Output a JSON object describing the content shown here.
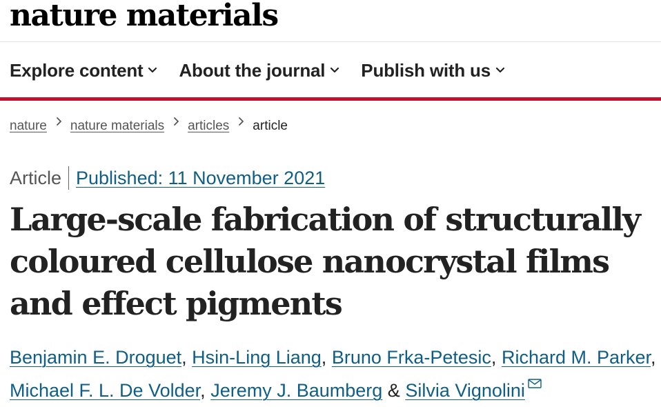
{
  "header": {
    "logo_text": "nature materials"
  },
  "nav": {
    "items": [
      {
        "label": "Explore content"
      },
      {
        "label": "About the journal"
      },
      {
        "label": "Publish with us"
      }
    ]
  },
  "breadcrumb": {
    "items": [
      "nature",
      "nature materials",
      "articles"
    ],
    "current": "article",
    "separator_icon": "chevron-right-icon"
  },
  "article": {
    "type": "Article",
    "published": "Published: 11 November 2021",
    "title": "Large-scale fabrication of structurally coloured cellulose nanocrystal films and effect pigments",
    "authors": [
      "Benjamin E. Droguet",
      "Hsin-Ling Liang",
      "Bruno Frka-Petesic",
      "Richard M. Parker",
      "Michael F. L. De Volder",
      "Jeremy J. Baumberg",
      "Silvia Vignolini"
    ],
    "author_separator": ",",
    "last_separator": "&",
    "corresponding_icon": "mail-icon"
  },
  "colors": {
    "accent_bar": "#c6102b",
    "link": "#0f5e87",
    "text": "#222222"
  }
}
